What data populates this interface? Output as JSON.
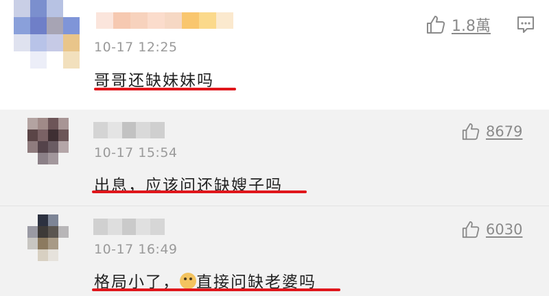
{
  "comments": [
    {
      "time": "10-17 12:25",
      "text": "哥哥还缺妹妹吗",
      "likes": "1.8萬",
      "has_reply_icon": true
    },
    {
      "time": "10-17 15:54",
      "text": "出息，应该问还缺嫂子吗",
      "likes": "8679"
    },
    {
      "time": "10-17 16:49",
      "text_before": "格局小了，",
      "text_after": "直接问缺老婆吗",
      "emoji": "dog-face-emoji",
      "likes": "6030"
    }
  ],
  "icons": {
    "like": "thumbs-up-icon",
    "reply": "comment-icon"
  },
  "colors": {
    "highlight_underline": "#e0161b",
    "meta_text": "#9a9a9a",
    "link_text": "#8a8a8a"
  }
}
